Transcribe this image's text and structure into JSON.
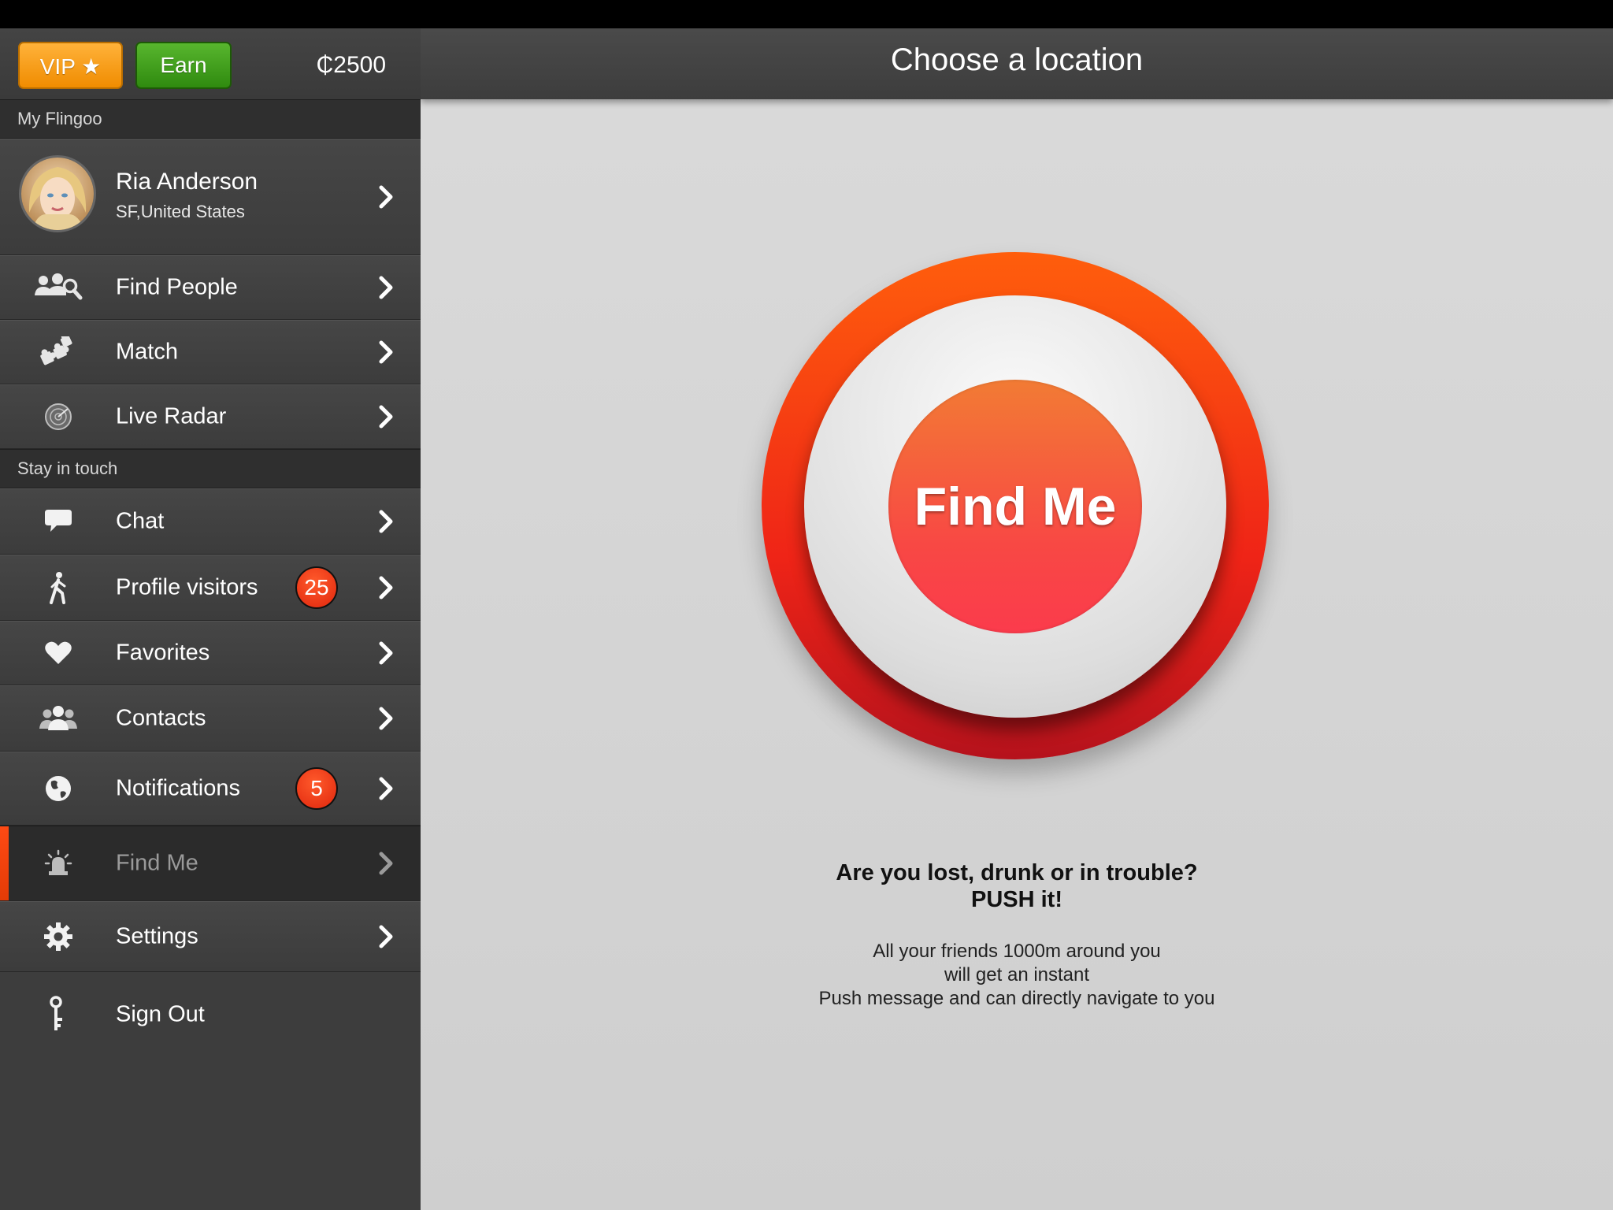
{
  "sidebar": {
    "vip_label": "VIP ★",
    "earn_label": "Earn",
    "coins": "₵2500",
    "section_my": "My Flingoo",
    "profile": {
      "name": "Ria Anderson",
      "location": "SF,United States"
    },
    "section_stay": "Stay in touch",
    "items": {
      "find_people": "Find People",
      "match": "Match",
      "live_radar": "Live Radar",
      "chat": "Chat",
      "profile_visitors": "Profile visitors",
      "profile_visitors_badge": "25",
      "favorites": "Favorites",
      "contacts": "Contacts",
      "notifications": "Notifications",
      "notifications_badge": "5",
      "find_me": "Find Me",
      "settings": "Settings",
      "sign_out": "Sign Out"
    },
    "active_item": "Find Me"
  },
  "main": {
    "title": "Choose a location",
    "button_label": "Find Me",
    "question_line1": "Are you lost, drunk or in trouble?",
    "question_line2": "PUSH it!",
    "desc_line1": "All your friends 1000m around you",
    "desc_line2": "will get an instant",
    "desc_line3": "Push message and  can directly navigate to you"
  },
  "colors": {
    "vip": "#f39a15",
    "earn": "#3f9c1c",
    "badge": "#e8300f",
    "ring_top": "#ff5e0c",
    "ring_bottom": "#b5121c",
    "button": "#f84844",
    "active_accent": "#ff4a14"
  },
  "icons": {
    "find_people": "people-search-icon",
    "match": "puzzle-icon",
    "live_radar": "radar-icon",
    "chat": "speech-bubble-icon",
    "profile_visitors": "walking-person-icon",
    "favorites": "heart-icon",
    "contacts": "contacts-icon",
    "notifications": "globe-icon",
    "find_me": "siren-icon",
    "settings": "gear-icon",
    "sign_out": "key-icon",
    "chevron": "chevron-right-icon"
  }
}
